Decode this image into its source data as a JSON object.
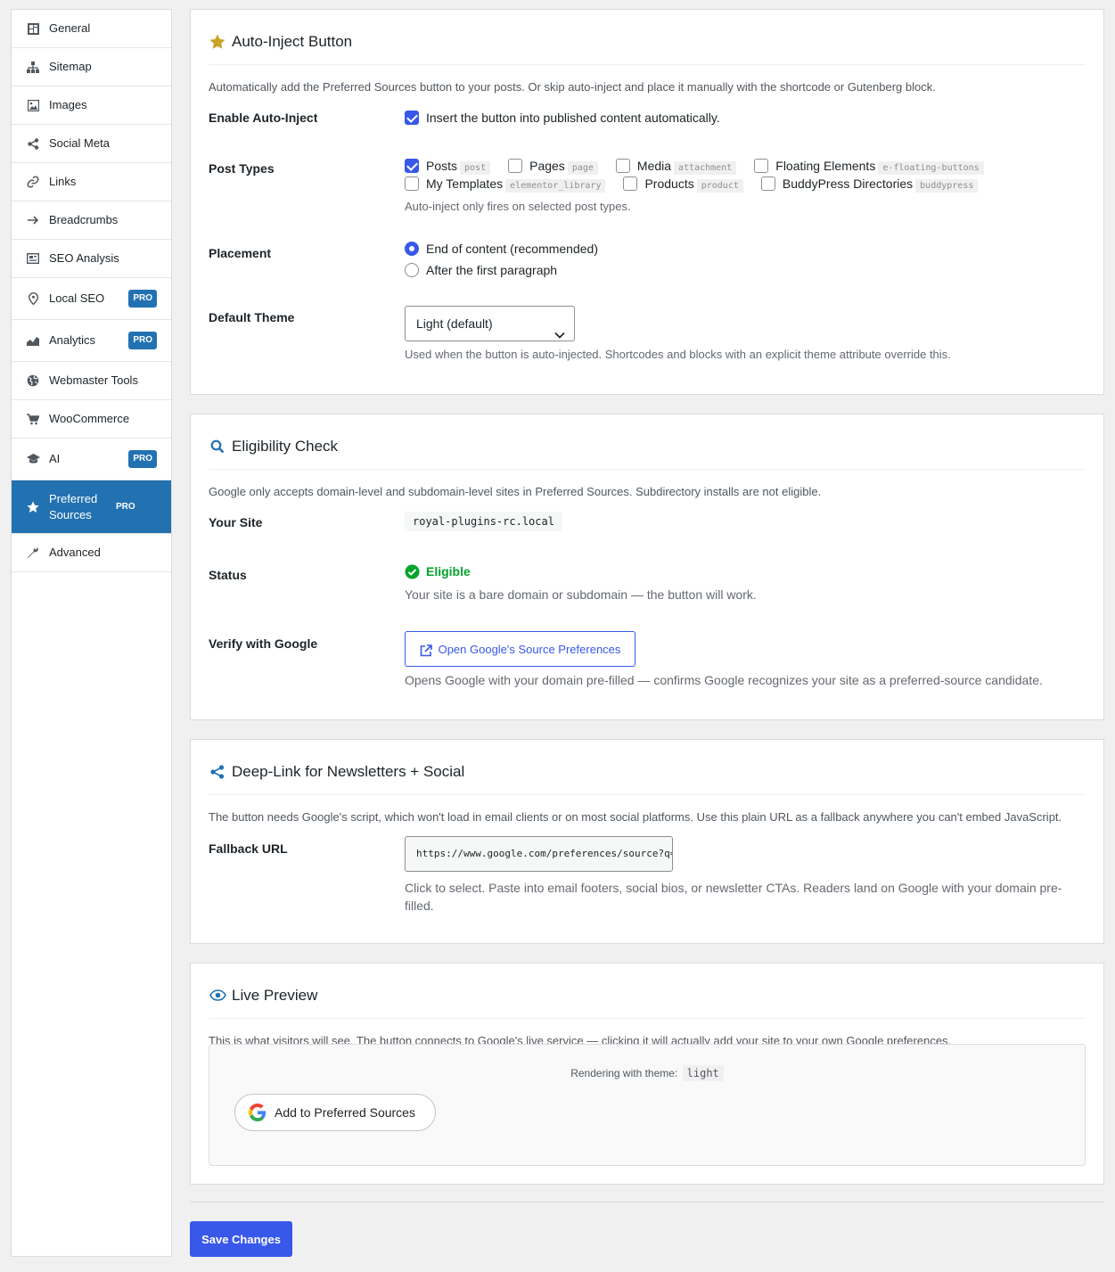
{
  "sidebar": {
    "items": [
      {
        "label": "General",
        "icon": "dashboard-icon"
      },
      {
        "label": "Sitemap",
        "icon": "sitemap-icon"
      },
      {
        "label": "Images",
        "icon": "image-icon"
      },
      {
        "label": "Social Meta",
        "icon": "share-icon"
      },
      {
        "label": "Links",
        "icon": "link-icon"
      },
      {
        "label": "Breadcrumbs",
        "icon": "arrow-right-icon"
      },
      {
        "label": "SEO Analysis",
        "icon": "analysis-icon"
      },
      {
        "label": "Local SEO",
        "icon": "location-pin-icon",
        "badge": "PRO"
      },
      {
        "label": "Analytics",
        "icon": "chart-area-icon",
        "badge": "PRO"
      },
      {
        "label": "Webmaster Tools",
        "icon": "globe-icon"
      },
      {
        "label": "WooCommerce",
        "icon": "cart-icon"
      },
      {
        "label": "AI",
        "icon": "graduation-cap-icon",
        "badge": "PRO"
      },
      {
        "label": "Preferred Sources",
        "icon": "star-icon",
        "badge": "PRO",
        "active": true
      },
      {
        "label": "Advanced",
        "icon": "wrench-icon"
      }
    ]
  },
  "auto_inject": {
    "title": "Auto-Inject Button",
    "description": "Automatically add the Preferred Sources button to your posts. Or skip auto-inject and place it manually with the shortcode or Gutenberg block.",
    "enable_label": "Enable Auto-Inject",
    "enable_checkbox": "Insert the button into published content automatically.",
    "post_types_label": "Post Types",
    "post_types": [
      {
        "label": "Posts",
        "slug": "post",
        "checked": true
      },
      {
        "label": "Pages",
        "slug": "page",
        "checked": false
      },
      {
        "label": "Media",
        "slug": "attachment",
        "checked": false
      },
      {
        "label": "Floating Elements",
        "slug": "e-floating-buttons",
        "checked": false
      },
      {
        "label": "My Templates",
        "slug": "elementor_library",
        "checked": false
      },
      {
        "label": "Products",
        "slug": "product",
        "checked": false
      },
      {
        "label": "BuddyPress Directories",
        "slug": "buddypress",
        "checked": false
      }
    ],
    "post_types_help": "Auto-inject only fires on selected post types.",
    "placement_label": "Placement",
    "placement_options": [
      "End of content (recommended)",
      "After the first paragraph"
    ],
    "placement_selected": 0,
    "theme_label": "Default Theme",
    "theme_value": "Light (default)",
    "theme_help": "Used when the button is auto-injected. Shortcodes and blocks with an explicit theme attribute override this."
  },
  "eligibility": {
    "title": "Eligibility Check",
    "description": "Google only accepts domain-level and subdomain-level sites in Preferred Sources. Subdirectory installs are not eligible.",
    "site_label": "Your Site",
    "site_value": "royal-plugins-rc.local",
    "status_label": "Status",
    "status_value": "Eligible",
    "status_help": "Your site is a bare domain or subdomain — the button will work.",
    "verify_label": "Verify with Google",
    "verify_button": "Open Google's Source Preferences",
    "verify_help": "Opens Google with your domain pre-filled — confirms Google recognizes your site as a preferred-source candidate."
  },
  "deeplink": {
    "title": "Deep-Link for Newsletters + Social",
    "description": "The button needs Google's script, which won't load in email clients or on most social platforms. Use this plain URL as a fallback anywhere you can't embed JavaScript.",
    "fallback_label": "Fallback URL",
    "fallback_value": "https://www.google.com/preferences/source?q=royal-plugins-rc.local",
    "fallback_help_1": "Click to select. Paste into email footers, social bios, or newsletter CTAs. Readers land on Google with your domain pre-",
    "fallback_help_2": "filled."
  },
  "preview": {
    "title": "Live Preview",
    "description": "This is what visitors will see. The button connects to Google's live service — clicking it will actually add your site to your own Google preferences.",
    "rendering_label": "Rendering with theme:",
    "rendering_theme": "light",
    "button_label": "Add to Preferred Sources"
  },
  "save_label": "Save Changes",
  "colors": {
    "accent": "#3858e9",
    "sidebar_active": "#2271b1",
    "success": "#00a32a",
    "star": "#c9a227"
  }
}
